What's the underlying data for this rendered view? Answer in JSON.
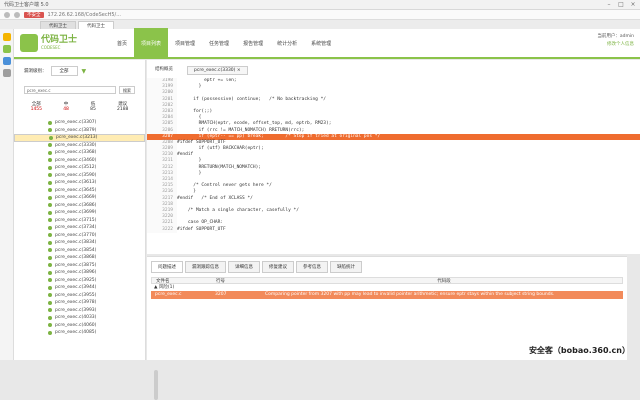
{
  "window": {
    "title": "代码卫士客户端 5.0"
  },
  "address": {
    "warning": "不安全",
    "url": "172.26.62.168/CodeSecH5/..."
  },
  "tabs": [
    {
      "label": "代码卫士"
    },
    {
      "label": "代码卫士"
    }
  ],
  "logo": {
    "text": "代码卫士",
    "sub": "CODESEC"
  },
  "menu": [
    "首页",
    "项目列表",
    "项目管理",
    "任务管理",
    "报告管理",
    "统计分析",
    "系统管理"
  ],
  "user": {
    "line1": "当前用户：admin",
    "link": "修改个人信息"
  },
  "filter": {
    "label": "漏洞级别：",
    "value": "全部"
  },
  "search": {
    "placeholder": "pcre_exec.c",
    "button": "搜索"
  },
  "stats": [
    {
      "label": "全部",
      "value": "1455"
    },
    {
      "label": "中",
      "value": "48"
    },
    {
      "label": "低",
      "value": "85"
    },
    {
      "label": "建议",
      "value": "2188"
    }
  ],
  "tree": [
    "pcre_exec.c(3307)",
    "pcre_exec.c(3879)",
    "pcre_exec.c(3213)",
    "pcre_exec.c(3330)",
    "pcre_exec.c(3368)",
    "pcre_exec.c(3460)",
    "pcre_exec.c(3512)",
    "pcre_exec.c(3590)",
    "pcre_exec.c(3613)",
    "pcre_exec.c(3645)",
    "pcre_exec.c(3669)",
    "pcre_exec.c(3686)",
    "pcre_exec.c(3699)",
    "pcre_exec.c(3715)",
    "pcre_exec.c(3734)",
    "pcre_exec.c(3770)",
    "pcre_exec.c(3834)",
    "pcre_exec.c(3854)",
    "pcre_exec.c(3868)",
    "pcre_exec.c(3875)",
    "pcre_exec.c(3896)",
    "pcre_exec.c(3925)",
    "pcre_exec.c(3944)",
    "pcre_exec.c(3955)",
    "pcre_exec.c(3978)",
    "pcre_exec.c(3993)",
    "pcre_exec.c(4033)",
    "pcre_exec.c(4060)",
    "pcre_exec.c(4085)"
  ],
  "tree_selected": 2,
  "main": {
    "crumb": "结构概览",
    "file_tab": "pcre_exec.c(3330) ×"
  },
  "code": [
    {
      "no": "3198",
      "tx": "          eptr += len;"
    },
    {
      "no": "3199",
      "tx": "        }"
    },
    {
      "no": "3200",
      "tx": ""
    },
    {
      "no": "3201",
      "tx": "      if (possessive) continue;   /* No backtracking */"
    },
    {
      "no": "3202",
      "tx": ""
    },
    {
      "no": "3203",
      "tx": "      for(;;)"
    },
    {
      "no": "3204",
      "tx": "        {"
    },
    {
      "no": "3205",
      "tx": "        RMATCH(eptr, ecode, offset_top, md, eptrb, RM23);"
    },
    {
      "no": "3206",
      "tx": "        if (rrc != MATCH_NOMATCH) RRETURN(rrc);"
    },
    {
      "no": "3207",
      "tx": "        if (eptr-- == pp) break;        /* Stop if tried at original pos */",
      "hl": true
    },
    {
      "no": "3208",
      "tx": "#ifdef SUPPORT_UTF"
    },
    {
      "no": "3209",
      "tx": "        if (utf) BACKCHAR(eptr);"
    },
    {
      "no": "3210",
      "tx": "#endif"
    },
    {
      "no": "3211",
      "tx": "        }"
    },
    {
      "no": "3212",
      "tx": "        RRETURN(MATCH_NOMATCH);"
    },
    {
      "no": "3213",
      "tx": "        }"
    },
    {
      "no": "3214",
      "tx": ""
    },
    {
      "no": "3215",
      "tx": "      /* Control never gets here */"
    },
    {
      "no": "3216",
      "tx": "      }"
    },
    {
      "no": "3217",
      "tx": "#endif   /* End of XCLASS */"
    },
    {
      "no": "3218",
      "tx": ""
    },
    {
      "no": "3219",
      "tx": "    /* Match a single character, casefully */"
    },
    {
      "no": "3220",
      "tx": ""
    },
    {
      "no": "3221",
      "tx": "    case OP_CHAR:"
    },
    {
      "no": "3222",
      "tx": "#ifdef SUPPORT_UTF"
    }
  ],
  "bottom": {
    "tabs": [
      "问题描述",
      "漏洞跟踪信息",
      "详细信息",
      "修复建议",
      "参考信息",
      "缺陷统计"
    ],
    "headers": [
      "文件名",
      "行号",
      "代码段"
    ],
    "group": "▲ 风险(1)",
    "row": {
      "file": "pcre_exec.c",
      "line": "3207",
      "desc": "Comparing pointer from 3207 with pp may lead to invalid pointer arithmetic; ensure eptr stays within the subject string bounds."
    }
  },
  "watermark": "安全客（bobao.360.cn）",
  "colors": {
    "accent": "#8bc34a",
    "highlight": "#ef6c2f",
    "warning": "#d9534f"
  }
}
